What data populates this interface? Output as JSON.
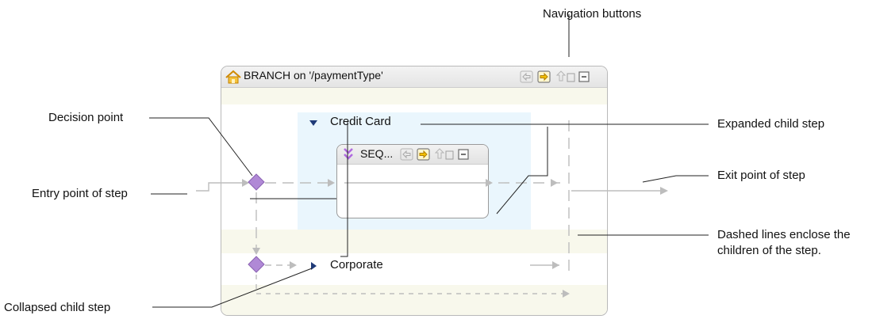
{
  "callouts": {
    "navigation_buttons": "Navigation buttons",
    "decision_point": "Decision point",
    "expanded_child_step": "Expanded child step",
    "exit_point": "Exit point of step",
    "entry_point": "Entry point of step",
    "dashed_lines": "Dashed lines enclose the children of the step.",
    "collapsed_child_step": "Collapsed child step"
  },
  "step": {
    "title": "BRANCH on '/paymentType'",
    "children": {
      "expanded": {
        "label": "Credit Card",
        "inner_title": "SEQ..."
      },
      "collapsed": {
        "label": "Corporate"
      }
    }
  },
  "colors": {
    "diamond": "#b089d6",
    "diamond_border": "#8a62b3",
    "nav_active": "#f0b400",
    "nav_inactive": "#9a9a9a",
    "connector": "#bdbdbd",
    "highlight": "#eaf6fd"
  }
}
